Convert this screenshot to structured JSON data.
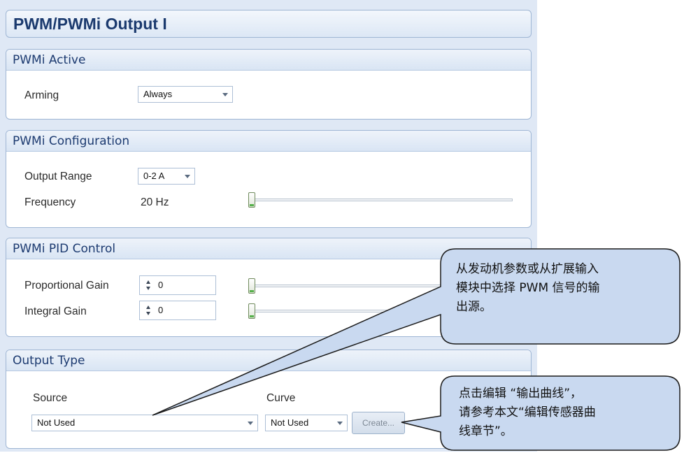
{
  "page_title": "PWM/PWMi Output I",
  "pwmi_active": {
    "header": "PWMi Active",
    "arming_label": "Arming",
    "arming_value": "Always"
  },
  "pwmi_configuration": {
    "header": "PWMi Configuration",
    "output_range_label": "Output Range",
    "output_range_value": "0-2 A",
    "frequency_label": "Frequency",
    "frequency_value": "20 Hz",
    "frequency_slider_fraction": 0.0
  },
  "pwmi_pid_control": {
    "header": "PWMi PID Control",
    "proportional_gain_label": "Proportional Gain",
    "proportional_gain_value": "0",
    "integral_gain_label": "Integral Gain",
    "integral_gain_value": "0"
  },
  "output_type": {
    "header": "Output Type",
    "source_label": "Source",
    "source_value": "Not Used",
    "curve_label": "Curve",
    "curve_value": "Not Used",
    "create_button": "Create..."
  },
  "callouts": {
    "source_note_lines": [
      "从发动机参数或从扩展输入",
      "模块中选择 PWM 信号的输",
      "出源。"
    ],
    "create_note_lines": [
      "点击编辑 “输出曲线”，",
      "请参考本文“编辑传感器曲",
      "线章节”。"
    ]
  },
  "colors": {
    "callout_fill": "#c9d9f0",
    "header_text": "#1b3a6e",
    "slider_accent": "#55b04a"
  }
}
